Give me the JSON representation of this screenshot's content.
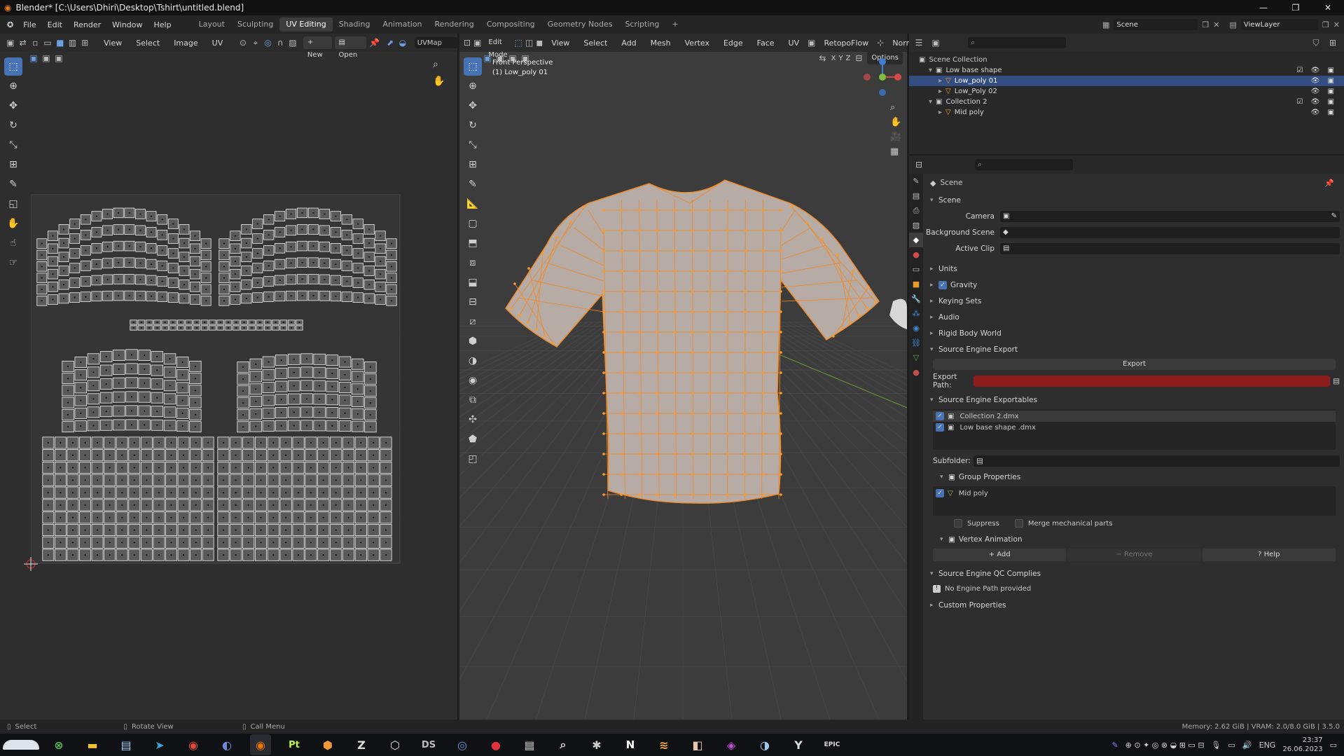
{
  "window": {
    "title": "Blender* [C:\\Users\\Dhiri\\Desktop\\Tshirt\\untitled.blend]"
  },
  "menu": {
    "items": [
      "File",
      "Edit",
      "Render",
      "Window",
      "Help"
    ]
  },
  "workspaces": [
    "Layout",
    "Sculpting",
    "UV Editing",
    "Shading",
    "Animation",
    "Rendering",
    "Compositing",
    "Geometry Nodes",
    "Scripting"
  ],
  "workspace_add": "+",
  "topright": {
    "scene": "Scene",
    "viewlayer": "ViewLayer"
  },
  "uv_header": {
    "menus": [
      "View",
      "Select",
      "Image",
      "UV"
    ],
    "new": "New",
    "open": "Open",
    "uvmap": "UVMap"
  },
  "vp_header": {
    "mode": "Edit Mode",
    "menus": [
      "View",
      "Select",
      "Add",
      "Mesh",
      "Vertex",
      "Edge",
      "Face",
      "UV"
    ],
    "addon": "RetopoFlow",
    "orientation": "Normal",
    "options": "Options",
    "axes": [
      "X",
      "Y",
      "Z"
    ]
  },
  "viewport": {
    "view_name": "Front Perspective",
    "object_name": "(1) Low_poly 01"
  },
  "outliner": {
    "root": "Scene Collection",
    "items": [
      {
        "label": "Low base shape",
        "level": 1
      },
      {
        "label": "Low_poly 01",
        "level": 2,
        "selected": true
      },
      {
        "label": "Low_Poly 02",
        "level": 2
      },
      {
        "label": "Collection 2",
        "level": 1
      },
      {
        "label": "Mid poly",
        "level": 2
      }
    ]
  },
  "props": {
    "crumb": "Scene",
    "scene_section": "Scene",
    "camera_label": "Camera",
    "background_label": "Background Scene",
    "clip_label": "Active Clip",
    "sections": [
      "Units",
      "Gravity",
      "Keying Sets",
      "Audio",
      "Rigid Body World"
    ],
    "export_section": "Source Engine Export",
    "export_btn": "Export",
    "export_path_label": "Export Path:",
    "exportables_section": "Source Engine Exportables",
    "exportables": [
      "Collection 2.dmx",
      "Low base shape .dmx"
    ],
    "subfolder_label": "Subfolder:",
    "group_props": "Group Properties",
    "group_item": "Mid poly",
    "suppress": "Suppress",
    "merge": "Merge mechanical parts",
    "vertex_anim": "Vertex Animation",
    "add": "Add",
    "remove": "Remove",
    "help": "Help",
    "qc_section": "Source Engine QC Complies",
    "no_engine": "No Engine Path provided",
    "custom_props": "Custom Properties",
    "accent": "#4772b3",
    "error": "#8c1d1d"
  },
  "status": {
    "select": "Select",
    "rotate": "Rotate View",
    "menu": "Call Menu",
    "memory": "Memory: 2.62 GiB | VRAM: 2.0/8.0 GiB | 3.5.0"
  },
  "taskbar": {
    "apps": [
      "Pt",
      "DS",
      "N",
      "EPIC"
    ],
    "lang": "ENG",
    "time": "23:37",
    "date": "26.06.2023"
  }
}
